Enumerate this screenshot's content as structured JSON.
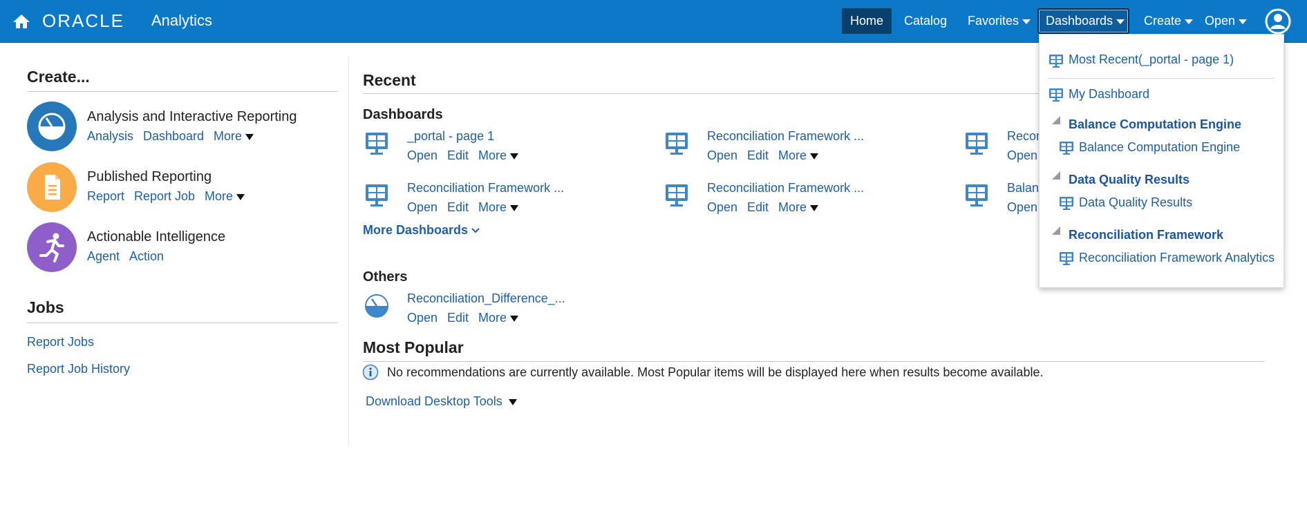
{
  "brand": {
    "oracle": "ORACLE",
    "product": "Analytics"
  },
  "nav": {
    "home": "Home",
    "catalog": "Catalog",
    "favorites": "Favorites",
    "dashboards": "Dashboards",
    "create": "Create",
    "open": "Open"
  },
  "create": {
    "title": "Create...",
    "categories": [
      {
        "title": "Analysis and Interactive Reporting",
        "links": [
          "Analysis",
          "Dashboard"
        ],
        "more": "More"
      },
      {
        "title": "Published Reporting",
        "links": [
          "Report",
          "Report Job"
        ],
        "more": "More"
      },
      {
        "title": "Actionable Intelligence",
        "links": [
          "Agent",
          "Action"
        ]
      }
    ]
  },
  "jobs": {
    "title": "Jobs",
    "links": [
      "Report Jobs",
      "Report Job History"
    ]
  },
  "recent": {
    "title": "Recent",
    "dashboards_title": "Dashboards",
    "dashboards": [
      {
        "name": "_portal - page 1"
      },
      {
        "name": "Reconciliation Framework ..."
      },
      {
        "name": "Recon"
      },
      {
        "name": "Reconciliation Framework ..."
      },
      {
        "name": "Reconciliation Framework ..."
      },
      {
        "name": "Balan"
      }
    ],
    "actions": {
      "open": "Open",
      "edit": "Edit",
      "more": "More"
    },
    "more_dashboards": "More Dashboards",
    "others_title": "Others",
    "others": [
      {
        "name": "Reconciliation_Difference_..."
      }
    ]
  },
  "popular": {
    "title": "Most Popular",
    "message": "No recommendations are currently available. Most Popular items will be displayed here when results become available."
  },
  "download": "Download Desktop Tools",
  "dropdown": {
    "most_recent": "Most Recent(_portal - page 1)",
    "my_dashboard": "My Dashboard",
    "groups": [
      {
        "title": "Balance Computation Engine",
        "item": "Balance Computation Engine"
      },
      {
        "title": "Data Quality Results",
        "item": "Data Quality Results"
      },
      {
        "title": "Reconciliation Framework",
        "item": "Reconciliation Framework Analytics"
      }
    ]
  },
  "colors": {
    "topbar": "#0b78c8",
    "link": "#1f5fa6",
    "analysis_circle": "#2678b8",
    "published_circle": "#f8ab46",
    "actionable_circle": "#8e5fc9"
  }
}
